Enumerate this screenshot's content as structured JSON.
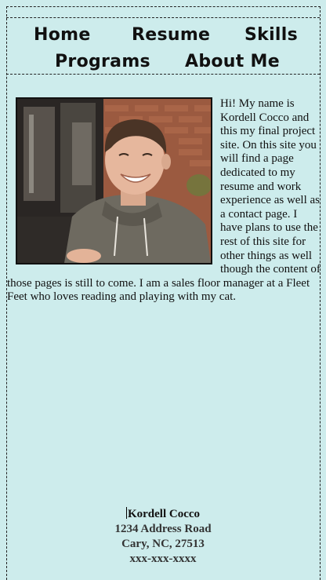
{
  "nav": {
    "items": [
      {
        "label": "Home"
      },
      {
        "label": "Resume"
      },
      {
        "label": "Skills"
      },
      {
        "label": "Programs"
      },
      {
        "label": "About Me"
      }
    ]
  },
  "main": {
    "intro": "Hi! My name is Kordell Cocco and this my final project site. On this site you will find a page dedicated to my resume and work experience as well as a contact page. I have plans to use the rest of this site for other things as well though the content of those pages is still to come. I am a sales floor manager at a Fleet Feet who loves reading and playing with my cat."
  },
  "footer": {
    "name": "Kordell Cocco",
    "address": "1234 Address Road",
    "city": "Cary, NC, 27513",
    "phone": "xxx-xxx-xxxx"
  },
  "colors": {
    "background": "#cdecec",
    "border": "#222222"
  }
}
